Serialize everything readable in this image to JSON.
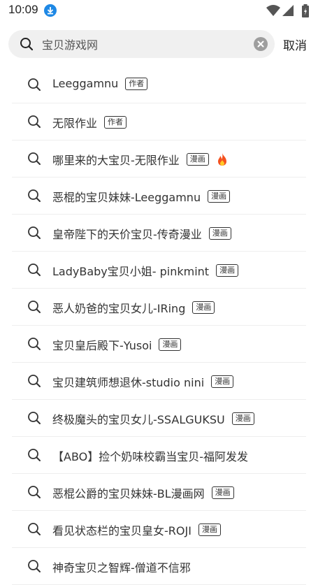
{
  "status_bar": {
    "time": "10:09"
  },
  "search": {
    "value": "宝贝游戏网",
    "cancel_label": "取消"
  },
  "results": [
    {
      "text": "Leeggamnu",
      "tag": "作者",
      "hot": false
    },
    {
      "text": "无限作业",
      "tag": "作者",
      "hot": false
    },
    {
      "text": "哪里来的大宝贝-无限作业",
      "tag": "漫画",
      "hot": true
    },
    {
      "text": "恶棍的宝贝妹妹-Leeggamnu",
      "tag": "漫画",
      "hot": false
    },
    {
      "text": "皇帝陛下的天价宝贝-传奇漫业",
      "tag": "漫画",
      "hot": false
    },
    {
      "text": "LadyBaby宝贝小姐- pinkmint",
      "tag": "漫画",
      "hot": false
    },
    {
      "text": "恶人奶爸的宝贝女儿-IRing",
      "tag": "漫画",
      "hot": false
    },
    {
      "text": "宝贝皇后殿下-Yusoi",
      "tag": "漫画",
      "hot": false
    },
    {
      "text": "宝贝建筑师想退休-studio nini",
      "tag": "漫画",
      "hot": false
    },
    {
      "text": "终极魔头的宝贝女儿-SSALGUKSU",
      "tag": "漫画",
      "hot": false
    },
    {
      "text": "【ABO】捡个奶味校霸当宝贝-福阿发发",
      "tag": "",
      "hot": false
    },
    {
      "text": "恶棍公爵的宝贝妹妹-BL漫画网",
      "tag": "漫画",
      "hot": false
    },
    {
      "text": "看见状态栏的宝贝皇女-ROJI",
      "tag": "漫画",
      "hot": false
    },
    {
      "text": "神奇宝贝之智辉-僧道不信邪",
      "tag": "",
      "hot": false
    }
  ]
}
